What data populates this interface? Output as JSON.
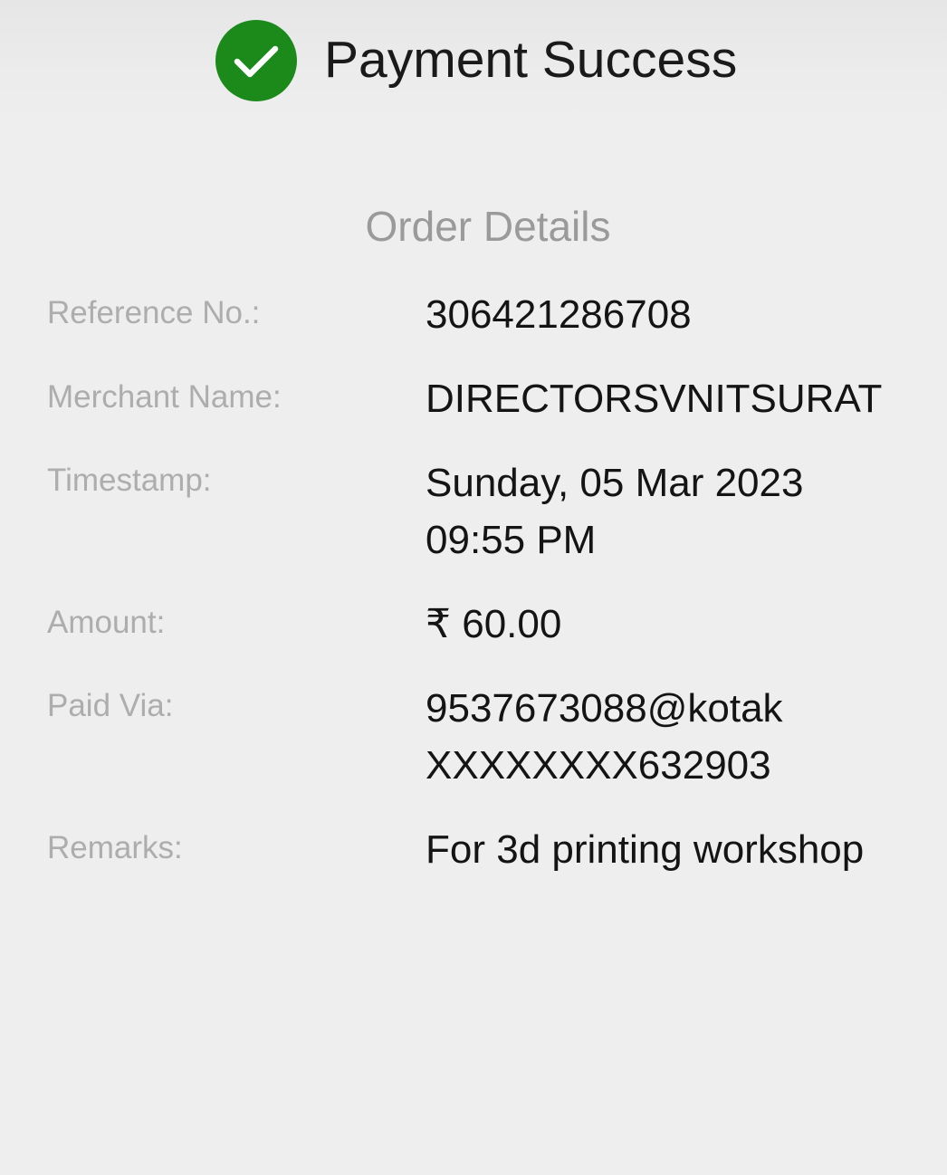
{
  "status": {
    "icon": "checkmark-circle-icon",
    "icon_color": "#1b8a1b",
    "title": "Payment Success"
  },
  "order_details": {
    "heading": "Order Details",
    "rows": [
      {
        "label": "Reference No.:",
        "value": "306421286708"
      },
      {
        "label": "Merchant Name:",
        "value": "DIRECTORSVNITSURAT"
      },
      {
        "label": "Timestamp:",
        "value_line1": "Sunday, 05 Mar 2023",
        "value_line2": "09:55 PM"
      },
      {
        "label": "Amount:",
        "value": "₹ 60.00"
      },
      {
        "label": "Paid Via:",
        "value_line1": "9537673088@kotak",
        "value_line2": "XXXXXXXX632903"
      },
      {
        "label": "Remarks:",
        "value": "For 3d printing workshop"
      }
    ]
  }
}
